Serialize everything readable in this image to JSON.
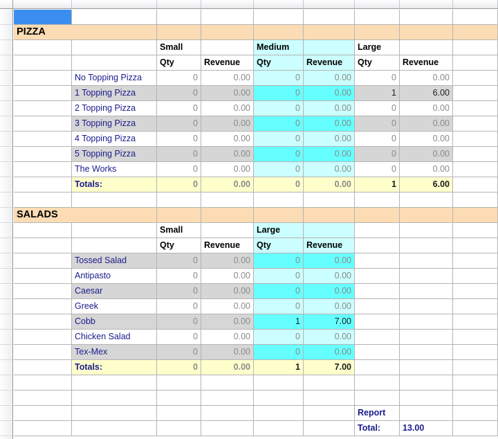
{
  "app": {
    "type": "spreadsheet",
    "selected_cell_empty_label": ""
  },
  "colors": {
    "section_band": "#fcdcb4",
    "size_highlight_light": "#ccffff",
    "size_highlight_bright": "#66ffff",
    "totals_row": "#ffffcc",
    "stripe_gray": "#d6d6d6",
    "selection": "#3a8ef0",
    "label_text": "#1a1a8c",
    "zero_value_text": "#8a8a8a"
  },
  "columns": {
    "boundaries": [
      20,
      104,
      227,
      291,
      367,
      439,
      513,
      578,
      655,
      720
    ]
  },
  "sections": [
    {
      "id": "pizza",
      "title": "PIZZA",
      "size_groups": [
        {
          "label": "Small",
          "highlighted": false
        },
        {
          "label": "Medium",
          "highlighted": true
        },
        {
          "label": "Large",
          "highlighted": false
        }
      ],
      "measure_headers": [
        "Qty",
        "Revenue",
        "Qty",
        "Revenue",
        "Qty",
        "Revenue"
      ],
      "rows": [
        {
          "name": "No Topping Pizza",
          "values": [
            "0",
            "0.00",
            "0",
            "0.00",
            "0",
            "0.00"
          ]
        },
        {
          "name": "1 Topping Pizza",
          "values": [
            "0",
            "0.00",
            "0",
            "0.00",
            "1",
            "6.00"
          ]
        },
        {
          "name": "2 Topping Pizza",
          "values": [
            "0",
            "0.00",
            "0",
            "0.00",
            "0",
            "0.00"
          ]
        },
        {
          "name": "3 Topping Pizza",
          "values": [
            "0",
            "0.00",
            "0",
            "0.00",
            "0",
            "0.00"
          ]
        },
        {
          "name": "4 Topping Pizza",
          "values": [
            "0",
            "0.00",
            "0",
            "0.00",
            "0",
            "0.00"
          ]
        },
        {
          "name": "5 Topping Pizza",
          "values": [
            "0",
            "0.00",
            "0",
            "0.00",
            "0",
            "0.00"
          ]
        },
        {
          "name": "The Works",
          "values": [
            "0",
            "0.00",
            "0",
            "0.00",
            "0",
            "0.00"
          ]
        }
      ],
      "totals": {
        "label": "Totals:",
        "values": [
          "0",
          "0.00",
          "0",
          "0.00",
          "1",
          "6.00"
        ]
      }
    },
    {
      "id": "salads",
      "title": "SALADS",
      "size_groups": [
        {
          "label": "Small",
          "highlighted": false
        },
        {
          "label": "Large",
          "highlighted": true
        }
      ],
      "measure_headers": [
        "Qty",
        "Revenue",
        "Qty",
        "Revenue"
      ],
      "rows": [
        {
          "name": "Tossed Salad",
          "values": [
            "0",
            "0.00",
            "0",
            "0.00"
          ]
        },
        {
          "name": "Antipasto",
          "values": [
            "0",
            "0.00",
            "0",
            "0.00"
          ]
        },
        {
          "name": "Caesar",
          "values": [
            "0",
            "0.00",
            "0",
            "0.00"
          ]
        },
        {
          "name": "Greek",
          "values": [
            "0",
            "0.00",
            "0",
            "0.00"
          ]
        },
        {
          "name": "Cobb",
          "values": [
            "0",
            "0.00",
            "1",
            "7.00"
          ]
        },
        {
          "name": "Chicken Salad",
          "values": [
            "0",
            "0.00",
            "0",
            "0.00"
          ]
        },
        {
          "name": "Tex-Mex",
          "values": [
            "0",
            "0.00",
            "0",
            "0.00"
          ]
        }
      ],
      "totals": {
        "label": "Totals:",
        "values": [
          "0",
          "0.00",
          "1",
          "7.00"
        ]
      }
    }
  ],
  "report_total": {
    "line1": "Report",
    "line2": "Total:",
    "value": "13.00"
  }
}
